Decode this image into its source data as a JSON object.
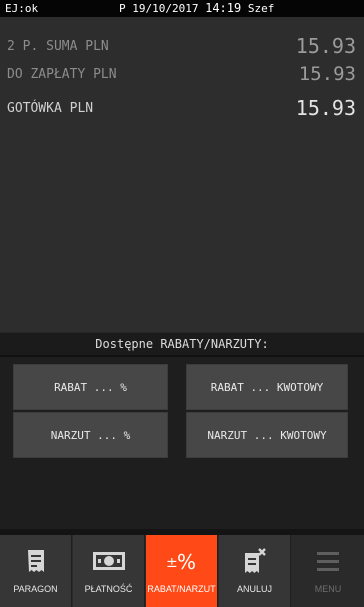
{
  "status": {
    "ej": "EJ:ok",
    "p": "P",
    "date": "19/10/2017",
    "time": "14:19",
    "user": "Szef"
  },
  "display": {
    "rows": [
      {
        "label": "2 P. SUMA PLN",
        "value": "15.93"
      },
      {
        "label": "DO ZAPŁATY PLN",
        "value": "15.93"
      },
      {
        "label": "GOTÓWKA PLN",
        "value": "15.93"
      }
    ]
  },
  "section": {
    "title": "Dostępne RABATY/NARZUTY:"
  },
  "buttons": {
    "rabat_percent": "RABAT ... %",
    "rabat_amount": "RABAT ... KWOTOWY",
    "narzut_percent": "NARZUT ... %",
    "narzut_amount": "NARZUT ... KWOTOWY"
  },
  "nav": {
    "items": [
      {
        "label": "PARAGON",
        "icon": "receipt-icon"
      },
      {
        "label": "PŁATNOŚĆ",
        "icon": "banknote-icon"
      },
      {
        "label": "RABAT/NARZUT",
        "icon": "plus-minus-percent-icon"
      },
      {
        "label": "ANULUJ",
        "icon": "cancel-receipt-icon"
      },
      {
        "label": "MENU",
        "icon": "menu-icon"
      }
    ],
    "active": "RABAT/NARZUT"
  },
  "colors": {
    "accent": "#ff4a17",
    "background": "#262626",
    "button": "#474747"
  }
}
